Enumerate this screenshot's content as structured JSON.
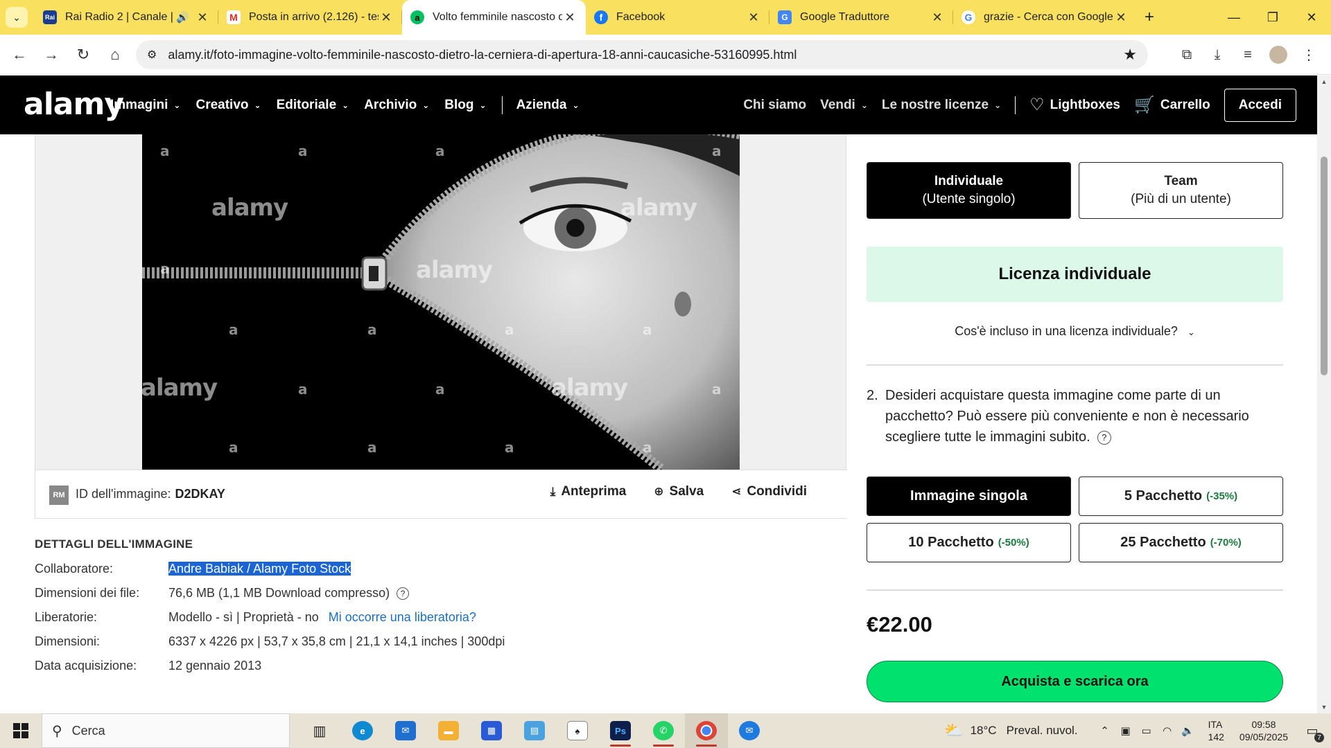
{
  "browser": {
    "tabs": [
      {
        "title": "Rai Radio 2 | Canale | R",
        "favicon": "rai-favicon",
        "color": "#1a3d8f",
        "fav_text": "Rai",
        "audio": true,
        "active": false
      },
      {
        "title": "Posta in arrivo (2.126) - tes",
        "favicon": "gmail-favicon",
        "color": "#ffffff",
        "fav_text": "M",
        "audio": false,
        "active": false
      },
      {
        "title": "Volto femminile nascosto d",
        "favicon": "alamy-favicon",
        "color": "#00c060",
        "fav_text": "a",
        "audio": false,
        "active": true
      },
      {
        "title": "Facebook",
        "favicon": "facebook-favicon",
        "color": "#1877f2",
        "fav_text": "f",
        "audio": false,
        "active": false
      },
      {
        "title": "Google Traduttore",
        "favicon": "google-translate-favicon",
        "color": "#4285f4",
        "fav_text": "G",
        "audio": false,
        "active": false
      },
      {
        "title": "grazie - Cerca con Google",
        "favicon": "google-favicon",
        "color": "#ffffff",
        "fav_text": "G",
        "audio": false,
        "active": false
      }
    ],
    "url": "alamy.it/foto-immagine-volto-femminile-nascosto-dietro-la-cerniera-di-apertura-18-anni-caucasiche-53160995.html"
  },
  "header": {
    "logo": "alamy",
    "nav_left": [
      "Immagini",
      "Creativo",
      "Editoriale",
      "Archivio",
      "Blog",
      "Azienda"
    ],
    "chi_siamo": "Chi siamo",
    "vendi": "Vendi",
    "licenze": "Le nostre licenze",
    "lightboxes": "Lightboxes",
    "carrello": "Carrello",
    "accedi": "Accedi"
  },
  "image": {
    "watermark_small": "a",
    "watermark_big": "alamy",
    "rm_badge": "RM",
    "id_label": "ID dell'immagine:",
    "id_value": "D2DKAY",
    "actions": {
      "anteprima": "Anteprima",
      "salva": "Salva",
      "condividi": "Condividi"
    }
  },
  "details": {
    "heading": "DETTAGLI DELL'IMMAGINE",
    "rows": [
      {
        "label": "Collaboratore:",
        "value": "Andre Babiak / Alamy Foto Stock"
      },
      {
        "label": "Dimensioni dei file:",
        "value": "76,6 MB (1,1 MB Download compresso)"
      },
      {
        "label": "Liberatorie:",
        "value": "Modello - sì | Proprietà - no",
        "link": "Mi occorre una liberatoria?"
      },
      {
        "label": "Dimensioni:",
        "value": "6337 x 4226 px | 53,7 x 35,8 cm | 21,1 x 14,1 inches | 300dpi"
      },
      {
        "label": "Data acquisizione:",
        "value": "12 gennaio 2013"
      }
    ]
  },
  "panel": {
    "individuale_title": "Individuale",
    "individuale_sub": "(Utente singolo)",
    "team_title": "Team",
    "team_sub": "(Più di un utente)",
    "banner": "Licenza individuale",
    "info": "Cos'è incluso in una licenza individuale?",
    "q2_num": "2.",
    "q2_text": "Desideri acquistare questa immagine come parte di un pacchetto? Può essere più conveniente e non è necessario scegliere tutte le immagini subito.",
    "packs": [
      {
        "label": "Immagine singola",
        "discount": ""
      },
      {
        "label": "5 Pacchetto",
        "discount": "(-35%)"
      },
      {
        "label": "10 Pacchetto",
        "discount": "(-50%)"
      },
      {
        "label": "25 Pacchetto",
        "discount": "(-70%)"
      }
    ],
    "price": "€22.00",
    "buy": "Acquista e scarica ora"
  },
  "taskbar": {
    "search": "Cerca",
    "weather_temp": "18°C",
    "weather_desc": "Preval. nuvol.",
    "lang_1": "ITA",
    "lang_2": "142",
    "time": "09:58",
    "date": "09/05/2025",
    "notif_count": "7"
  },
  "colors": {
    "tabstrip": "#f9e05e",
    "accent_green": "#00e16e",
    "banner_green": "#dcf8e8",
    "link_blue": "#1a6fc4",
    "selection_blue": "#1a64d6"
  }
}
